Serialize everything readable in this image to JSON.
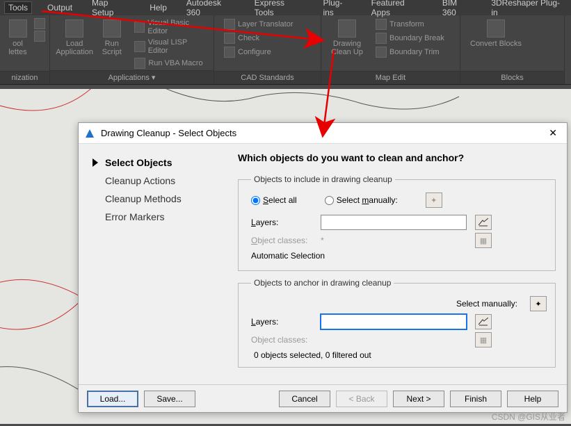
{
  "menubar": [
    "Tools",
    "Output",
    "Map Setup",
    "Help",
    "Autodesk 360",
    "Express Tools",
    "Plug-ins",
    "Featured Apps",
    "BIM 360",
    "3DReshaper Plug-in"
  ],
  "ribbon": {
    "panels": [
      {
        "title": "nization",
        "big": [
          {
            "label": "ool\nlettes"
          }
        ],
        "small": []
      },
      {
        "title": "Applications ▾",
        "big": [
          {
            "label": "Load\nApplication"
          },
          {
            "label": "Run\nScript"
          }
        ],
        "small": [
          "Visual Basic Editor",
          "Visual LISP Editor",
          "Run VBA Macro"
        ]
      },
      {
        "title": "CAD Standards",
        "big": [],
        "small": [
          "Layer Translator",
          "Check",
          "Configure"
        ]
      },
      {
        "title": "Map Edit",
        "big": [
          {
            "label": "Drawing\nClean Up"
          }
        ],
        "small": [
          "Transform",
          "Boundary Break",
          "Boundary Trim"
        ]
      },
      {
        "title": "Blocks",
        "big": [
          {
            "label": "Convert Blocks"
          }
        ],
        "small": []
      }
    ]
  },
  "dialog": {
    "title": "Drawing Cleanup - Select Objects",
    "nav": [
      {
        "label": "Select Objects",
        "active": true
      },
      {
        "label": "Cleanup Actions",
        "active": false
      },
      {
        "label": "Cleanup Methods",
        "active": false
      },
      {
        "label": "Error Markers",
        "active": false
      }
    ],
    "heading": "Which objects do you want to clean and anchor?",
    "include": {
      "legend": "Objects to include in drawing cleanup",
      "radio_all": "Select all",
      "radio_all_key": "S",
      "radio_manual": "Select manually:",
      "radio_manual_key": "m",
      "layers_label": "Layers:",
      "layers_key": "L",
      "layers_value": "",
      "classes_label": "Object classes:",
      "classes_key": "O",
      "classes_value": "*",
      "auto": "Automatic Selection"
    },
    "anchor": {
      "legend": "Objects to anchor in drawing cleanup",
      "manual_label": "Select manually:",
      "layers_label": "Layers:",
      "layers_key": "L",
      "layers_value": "",
      "classes_label": "Object classes:",
      "classes_value": "",
      "status": "0 objects selected, 0 filtered out"
    },
    "footer": {
      "load": "Load...",
      "save": "Save...",
      "cancel": "Cancel",
      "back": "< Back",
      "next": "Next >",
      "finish": "Finish",
      "help": "Help"
    }
  },
  "watermark": "CSDN @GIS从业者"
}
